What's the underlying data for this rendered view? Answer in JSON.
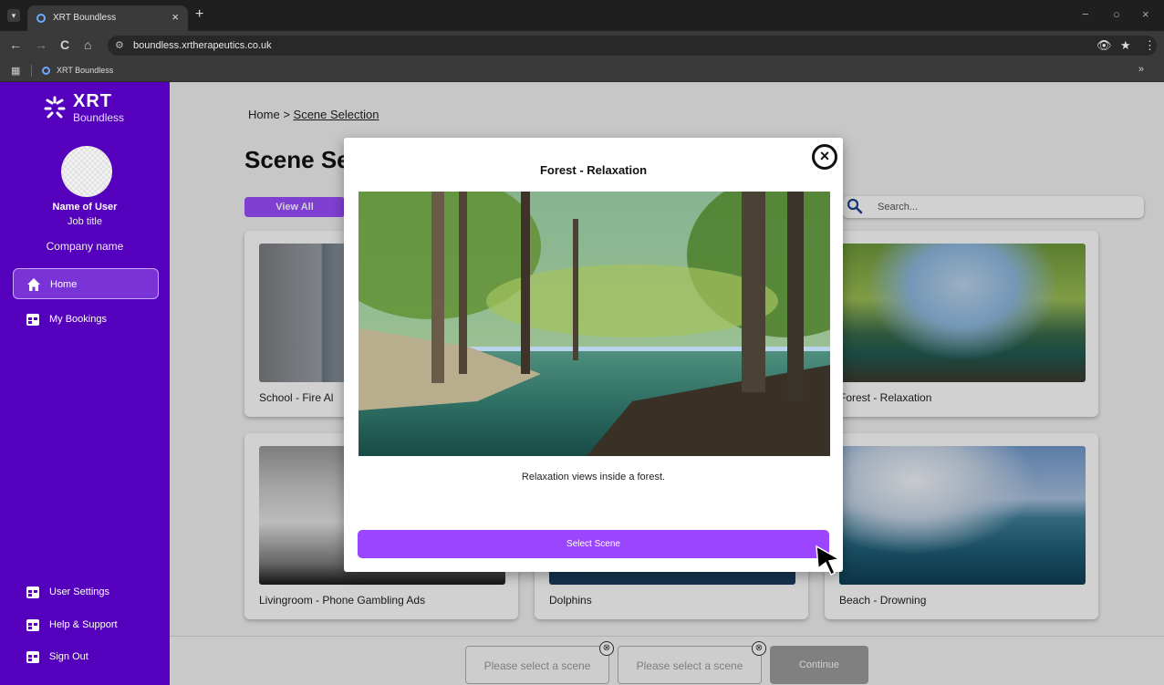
{
  "browser": {
    "tab_title": "XRT Boundless",
    "tab_close": "×",
    "new_tab": "+",
    "url": "boundless.xrtherapeutics.co.uk",
    "bookmark_title": "XRT Boundless",
    "more_bookmarks": "»",
    "nav": {
      "back": "←",
      "forward": "→",
      "reload": "C",
      "home": "⌂"
    },
    "window": {
      "minimize": "−",
      "maximize": "○",
      "close": "×"
    }
  },
  "sidebar": {
    "logo_main": "XRT",
    "logo_sub": "Boundless",
    "user_name": "Name of User",
    "job_title": "Job title",
    "company": "Company name",
    "items": [
      {
        "label": "Home",
        "icon": "home-icon",
        "active": true
      },
      {
        "label": "My Bookings",
        "icon": "bookings-icon",
        "active": false
      }
    ],
    "bottom_items": [
      {
        "label": "User Settings",
        "icon": "settings-icon"
      },
      {
        "label": "Help & Support",
        "icon": "help-icon"
      },
      {
        "label": "Sign Out",
        "icon": "sign-out-icon"
      }
    ]
  },
  "main": {
    "breadcrumb": {
      "home": "Home",
      "separator": ">",
      "current": "Scene Selection"
    },
    "title": "Scene Se",
    "filter_button": "View All",
    "search_placeholder": "Search...",
    "cards": [
      {
        "label": "School - Fire Al"
      },
      {
        "label": "Forest - Relaxation"
      },
      {
        "label": "Livingroom - Phone Gambling Ads"
      },
      {
        "label": "Dolphins"
      },
      {
        "label": "Beach - Drowning"
      }
    ]
  },
  "bottom_bar": {
    "slots": [
      "Please select a scene",
      "Please select a scene"
    ],
    "slot_remove": "⊗",
    "continue": "Continue"
  },
  "modal": {
    "title": "Forest - Relaxation",
    "close": "×",
    "description": "Relaxation views inside a forest.",
    "select_button": "Select Scene"
  },
  "colors": {
    "sidebar_bg": "#5400bd",
    "accent": "#9b45ff",
    "continue_disabled": "#9d9d9d"
  }
}
